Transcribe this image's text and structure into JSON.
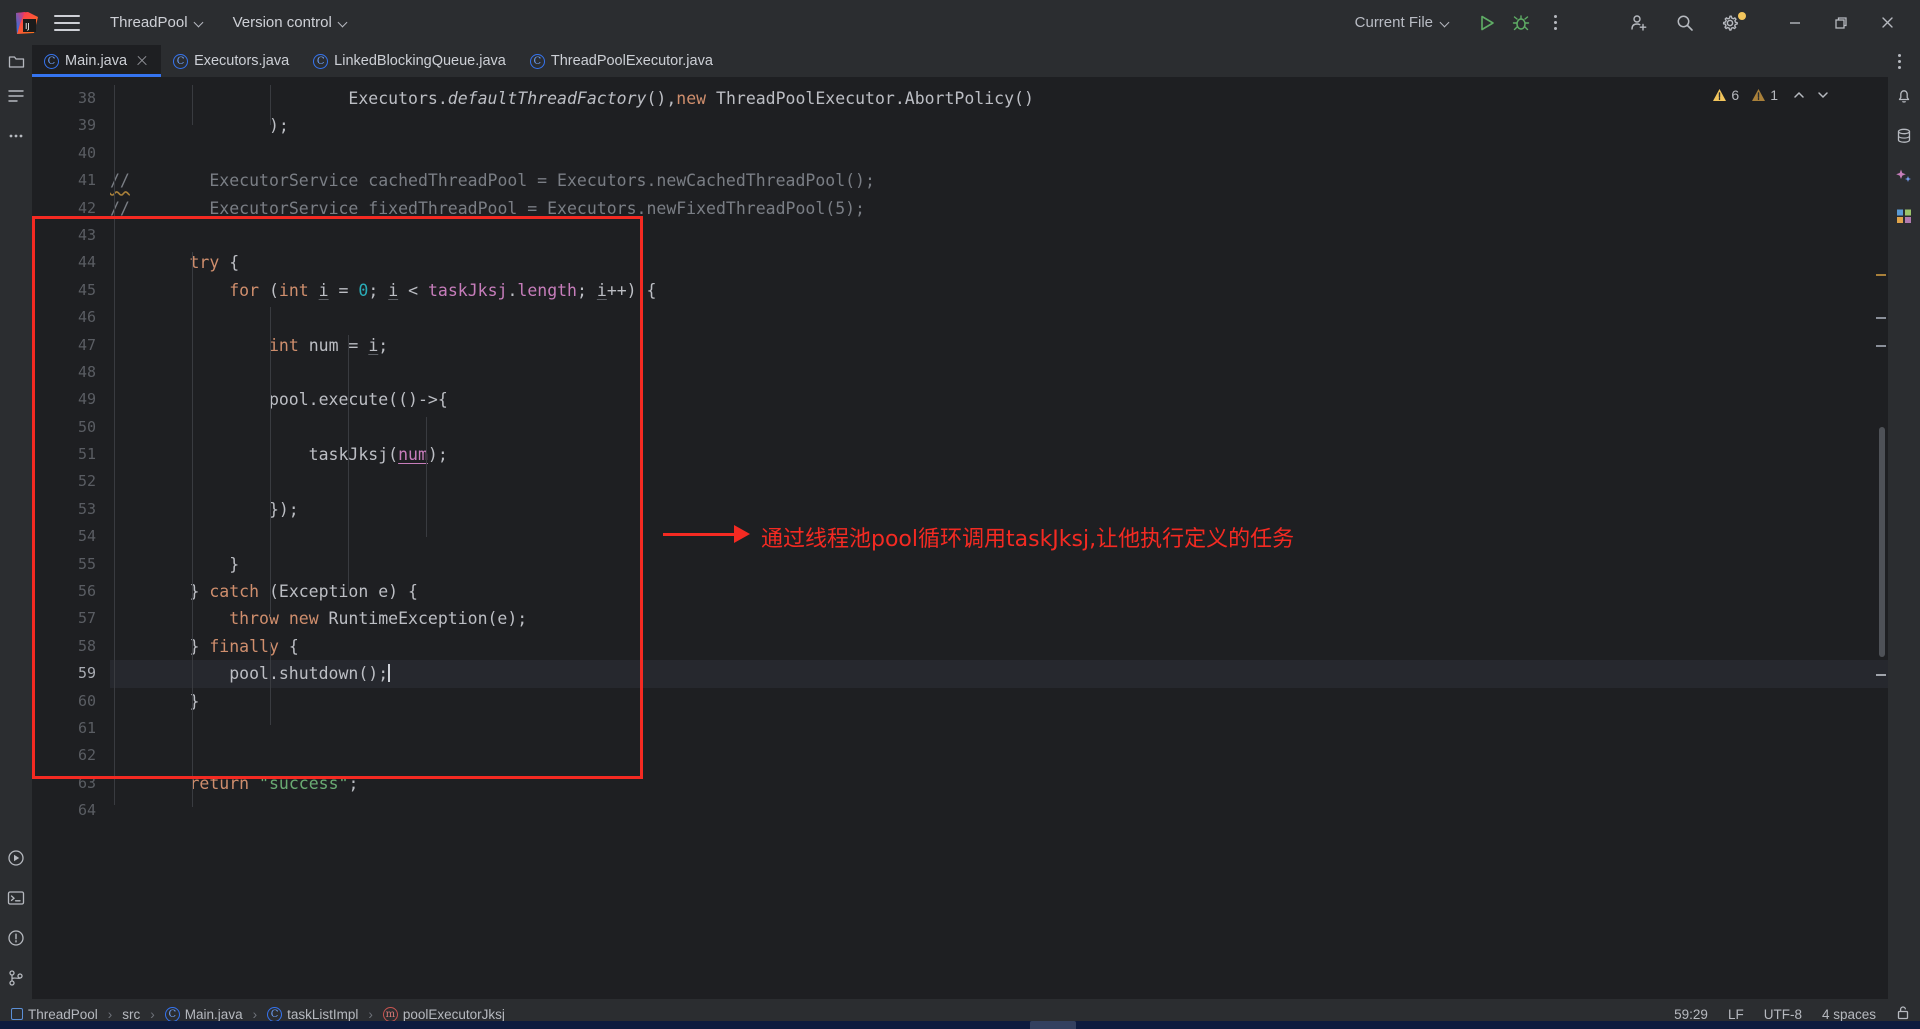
{
  "titlebar": {
    "menu_icon": "hamburger-menu-icon",
    "project_name": "ThreadPool",
    "vcs_label": "Version control",
    "run_config": "Current File",
    "run_icon": "run-play-icon",
    "debug_icon": "debug-bug-icon",
    "more_icon": "more-vertical-icon",
    "account_icon": "add-account-icon",
    "search_icon": "search-icon",
    "settings_icon": "gear-icon",
    "minimize_icon": "minimize-icon",
    "maximize_icon": "maximize-restore-icon",
    "close_icon": "close-icon"
  },
  "tabs": [
    {
      "label": "Main.java",
      "icon": "java-class-icon",
      "active": true,
      "closable": true
    },
    {
      "label": "Executors.java",
      "icon": "java-class-icon",
      "active": false,
      "closable": false
    },
    {
      "label": "LinkedBlockingQueue.java",
      "icon": "java-class-icon",
      "active": false,
      "closable": false
    },
    {
      "label": "ThreadPoolExecutor.java",
      "icon": "java-class-icon",
      "active": false,
      "closable": false
    }
  ],
  "tabbar": {
    "project_files_icon": "project-folder-icon",
    "options_icon": "tab-options-kebab-icon"
  },
  "inspections": {
    "warning_count": "6",
    "weak_warning_count": "1",
    "prev_icon": "chevron-up-icon",
    "next_icon": "chevron-down-icon"
  },
  "editor": {
    "first_line": 38,
    "current_line": 59,
    "lines": [
      {
        "n": 38,
        "html": "                        Executors.<i class='ital'>defaultThreadFactory</i>(),<span class='kw'>new</span> ThreadPoolExecutor.AbortPolicy()"
      },
      {
        "n": 39,
        "html": "                );"
      },
      {
        "n": 40,
        "html": ""
      },
      {
        "n": 41,
        "html": "<span class='cmt wavy'>//</span>        <span class='cmt'>ExecutorService cachedThreadPool = Executors.newCachedThreadPool();</span>"
      },
      {
        "n": 42,
        "html": "<span class='cmt'>//</span>        <span class='cmt'>ExecutorService fixedThreadPool = Executors.newFixedThreadPool(5);</span>"
      },
      {
        "n": 43,
        "html": ""
      },
      {
        "n": 44,
        "html": "        <span class='kw'>try</span> {"
      },
      {
        "n": 45,
        "html": "            <span class='kw'>for</span> (<span class='kw'>int</span> <span class='und'>i</span> = <span class='num'>0</span>; <span class='und'>i</span> &lt; <span class='fld'>taskJksj</span>.<span class='fld'>length</span>; <span class='und'>i</span>++) {"
      },
      {
        "n": 46,
        "html": ""
      },
      {
        "n": 47,
        "html": "                <span class='kw'>int</span> num = <span class='und'>i</span>;"
      },
      {
        "n": 48,
        "html": ""
      },
      {
        "n": 49,
        "html": "                pool.execute(()-&gt;{"
      },
      {
        "n": 50,
        "html": ""
      },
      {
        "n": 51,
        "html": "                    taskJksj(<span class='undp'>num</span>);"
      },
      {
        "n": 52,
        "html": ""
      },
      {
        "n": 53,
        "html": "                });"
      },
      {
        "n": 54,
        "html": ""
      },
      {
        "n": 55,
        "html": "            }"
      },
      {
        "n": 56,
        "html": "        } <span class='kw'>catch</span> (Exception e) {"
      },
      {
        "n": 57,
        "html": "            <span class='kw'>throw new</span> RuntimeException(e);"
      },
      {
        "n": 58,
        "html": "        } <span class='kw'>finally</span> {"
      },
      {
        "n": 59,
        "html": "            pool.shutdown();"
      },
      {
        "n": 60,
        "html": "        }"
      },
      {
        "n": 61,
        "html": ""
      },
      {
        "n": 62,
        "html": ""
      },
      {
        "n": 63,
        "html": "        <span class='kw'>return</span> <span class='str'>\"success\"</span>;"
      },
      {
        "n": 64,
        "html": ""
      }
    ]
  },
  "annotation": {
    "text": "通过线程池pool循环调用taskJksj,让他执行定义的任务",
    "color": "#f42a22",
    "arrow_icon": "right-arrow-annotation-icon",
    "box_icon": "red-highlight-rectangle"
  },
  "statusbar": {
    "breadcrumbs": [
      {
        "label": "ThreadPool",
        "icon": "module-icon"
      },
      {
        "label": "src",
        "icon": "folder-icon"
      },
      {
        "label": "Main.java",
        "icon": "java-class-icon"
      },
      {
        "label": "taskListImpl",
        "icon": "java-class-icon"
      },
      {
        "label": "poolExecutorJksj",
        "icon": "java-method-icon"
      }
    ],
    "caret": "59:29",
    "line_separator": "LF",
    "encoding": "UTF-8",
    "indent": "4 spaces",
    "lock_icon": "read-only-lock-icon"
  },
  "sidebars": {
    "left_top": [
      "project-folder-icon",
      "commit-structure-icon",
      "more-tools-icon"
    ],
    "left_bottom": [
      "run-tool-icon",
      "terminal-icon",
      "problems-icon",
      "git-branch-icon"
    ],
    "right": [
      "notifications-bell-icon",
      "database-icon",
      "ai-assistant-icon",
      "gradle-icon"
    ]
  },
  "colors": {
    "accent": "#3574f0",
    "annotation_red": "#f42a22",
    "keyword": "#cf8e6d",
    "comment": "#7a7e85",
    "string": "#6aab73",
    "number": "#2aacb8",
    "field": "#c77dbb",
    "editor_bg": "#1e1f22",
    "chrome_bg": "#2b2d30"
  }
}
